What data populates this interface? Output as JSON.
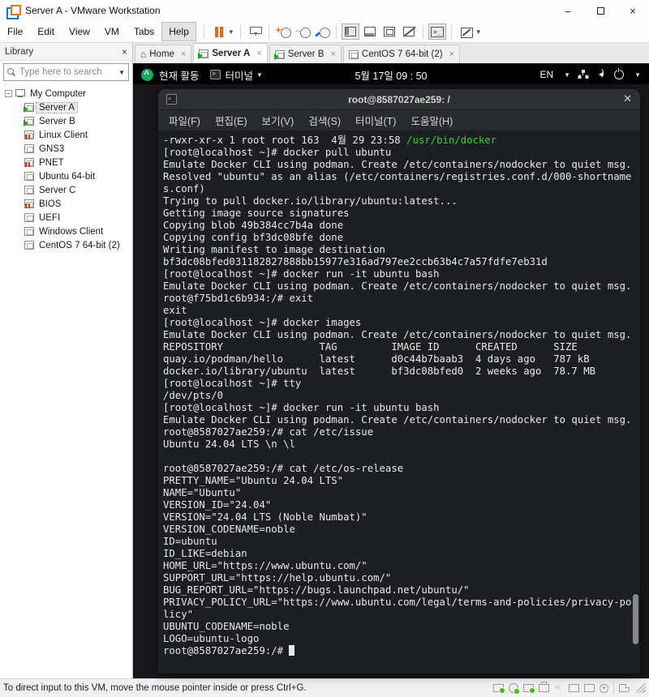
{
  "window": {
    "title": "Server A - VMware Workstation"
  },
  "menubar": {
    "items": [
      {
        "label": "File"
      },
      {
        "label": "Edit"
      },
      {
        "label": "View"
      },
      {
        "label": "VM"
      },
      {
        "label": "Tabs"
      },
      {
        "label": "Help",
        "highlighted": true
      }
    ]
  },
  "toolbar": {
    "groups": [
      [
        {
          "name": "pause-button",
          "caret": true
        }
      ],
      [
        {
          "name": "send-ctrl-alt-del"
        }
      ],
      [
        {
          "name": "take-snapshot",
          "clock": true
        },
        {
          "name": "revert-snapshot",
          "clock": true
        },
        {
          "name": "snapshot-manager",
          "clock": true
        }
      ],
      [
        {
          "name": "show-library",
          "view": true,
          "pressed": true
        },
        {
          "name": "show-thumbnail-bar",
          "view": true
        },
        {
          "name": "full-screen-view",
          "view": true
        },
        {
          "name": "unity-view",
          "view": true
        }
      ],
      [
        {
          "name": "console-view",
          "pressed": true
        }
      ],
      [
        {
          "name": "fit-guest",
          "caret": true
        }
      ]
    ]
  },
  "library": {
    "title": "Library",
    "close_icon": "×",
    "search_placeholder": "Type here to search",
    "tree": [
      {
        "label": "My Computer",
        "icon": "computer",
        "level": 0,
        "expanded": true
      },
      {
        "label": "Server A",
        "icon": "vm-running",
        "level": 1,
        "selected": true
      },
      {
        "label": "Server B",
        "icon": "vm-running",
        "level": 1
      },
      {
        "label": "Linux Client",
        "icon": "vm-suspended",
        "level": 1
      },
      {
        "label": "GNS3",
        "icon": "vm-off",
        "level": 1
      },
      {
        "label": "PNET",
        "icon": "vm-suspended",
        "level": 1
      },
      {
        "label": "Ubuntu 64-bit",
        "icon": "vm-off",
        "level": 1
      },
      {
        "label": "Server C",
        "icon": "vm-off",
        "level": 1
      },
      {
        "label": "BIOS",
        "icon": "vm-suspended",
        "level": 1
      },
      {
        "label": "UEFI",
        "icon": "vm-off",
        "level": 1
      },
      {
        "label": "Windows Client",
        "icon": "vm-off",
        "level": 1
      },
      {
        "label": "CentOS 7 64-bit (2)",
        "icon": "vm-off",
        "level": 1
      }
    ]
  },
  "tabs": [
    {
      "label": "Home",
      "icon": "home"
    },
    {
      "label": "Server A",
      "icon": "vm-running",
      "active": true
    },
    {
      "label": "Server B",
      "icon": "vm-running"
    },
    {
      "label": "CentOS 7 64-bit (2)",
      "icon": "vm-off"
    }
  ],
  "vm_topbar": {
    "activities_label": "현재 활동",
    "app_label": "터미널",
    "clock": "5월 17일 09 : 50",
    "language": "EN"
  },
  "terminal_window": {
    "title": "root@8587027ae259: /",
    "close_icon": "✕",
    "menus": [
      "파일(F)",
      "편집(E)",
      "보기(V)",
      "검색(S)",
      "터미널(T)",
      "도움말(H)"
    ],
    "green": "#30d230",
    "lines": [
      {
        "segs": [
          {
            "t": "-rwxr-xr-x 1 root root 163  4월 29 23:58 "
          },
          {
            "t": "/usr/bin/docker",
            "c": "#30d230"
          }
        ]
      },
      "[root@localhost ~]# docker pull ubuntu",
      "Emulate Docker CLI using podman. Create /etc/containers/nodocker to quiet msg.",
      "Resolved \"ubuntu\" as an alias (/etc/containers/registries.conf.d/000-shortname",
      "s.conf)",
      "Trying to pull docker.io/library/ubuntu:latest...",
      "Getting image source signatures",
      "Copying blob 49b384cc7b4a done",
      "Copying config bf3dc08bfe done",
      "Writing manifest to image destination",
      "bf3dc08bfed031182827888bb15977e316ad797ee2ccb63b4c7a57fdfe7eb31d",
      "[root@localhost ~]# docker run -it ubuntu bash",
      "Emulate Docker CLI using podman. Create /etc/containers/nodocker to quiet msg.",
      "root@f75bd1c6b934:/# exit",
      "exit",
      "[root@localhost ~]# docker images",
      "Emulate Docker CLI using podman. Create /etc/containers/nodocker to quiet msg.",
      "REPOSITORY                TAG         IMAGE ID      CREATED      SIZE",
      "quay.io/podman/hello      latest      d0c44b7baab3  4 days ago   787 kB",
      "docker.io/library/ubuntu  latest      bf3dc08bfed0  2 weeks ago  78.7 MB",
      "[root@localhost ~]# tty",
      "/dev/pts/0",
      "[root@localhost ~]# docker run -it ubuntu bash",
      "Emulate Docker CLI using podman. Create /etc/containers/nodocker to quiet msg.",
      "root@8587027ae259:/# cat /etc/issue",
      "Ubuntu 24.04 LTS \\n \\l",
      "",
      "root@8587027ae259:/# cat /etc/os-release",
      "PRETTY_NAME=\"Ubuntu 24.04 LTS\"",
      "NAME=\"Ubuntu\"",
      "VERSION_ID=\"24.04\"",
      "VERSION=\"24.04 LTS (Noble Numbat)\"",
      "VERSION_CODENAME=noble",
      "ID=ubuntu",
      "ID_LIKE=debian",
      "HOME_URL=\"https://www.ubuntu.com/\"",
      "SUPPORT_URL=\"https://help.ubuntu.com/\"",
      "BUG_REPORT_URL=\"https://bugs.launchpad.net/ubuntu/\"",
      "PRIVACY_POLICY_URL=\"https://www.ubuntu.com/legal/terms-and-policies/privacy-po",
      "licy\"",
      "UBUNTU_CODENAME=noble",
      "LOGO=ubuntu-logo",
      {
        "segs": [
          {
            "t": "root@8587027ae259:/# "
          }
        ],
        "cursor": true
      }
    ]
  },
  "statusbar": {
    "message": "To direct input to this VM, move the mouse pointer inside or press Ctrl+G.",
    "devices": [
      {
        "name": "hard-disk",
        "active": true
      },
      {
        "name": "cd-dvd",
        "active": true
      },
      {
        "name": "network-adapter",
        "active": true
      },
      {
        "name": "printer"
      },
      {
        "name": "sound"
      },
      {
        "name": "usb-device"
      },
      {
        "name": "usb-device-2"
      },
      {
        "name": "webcam"
      },
      {
        "name": "sep"
      },
      {
        "name": "message-log"
      }
    ]
  }
}
